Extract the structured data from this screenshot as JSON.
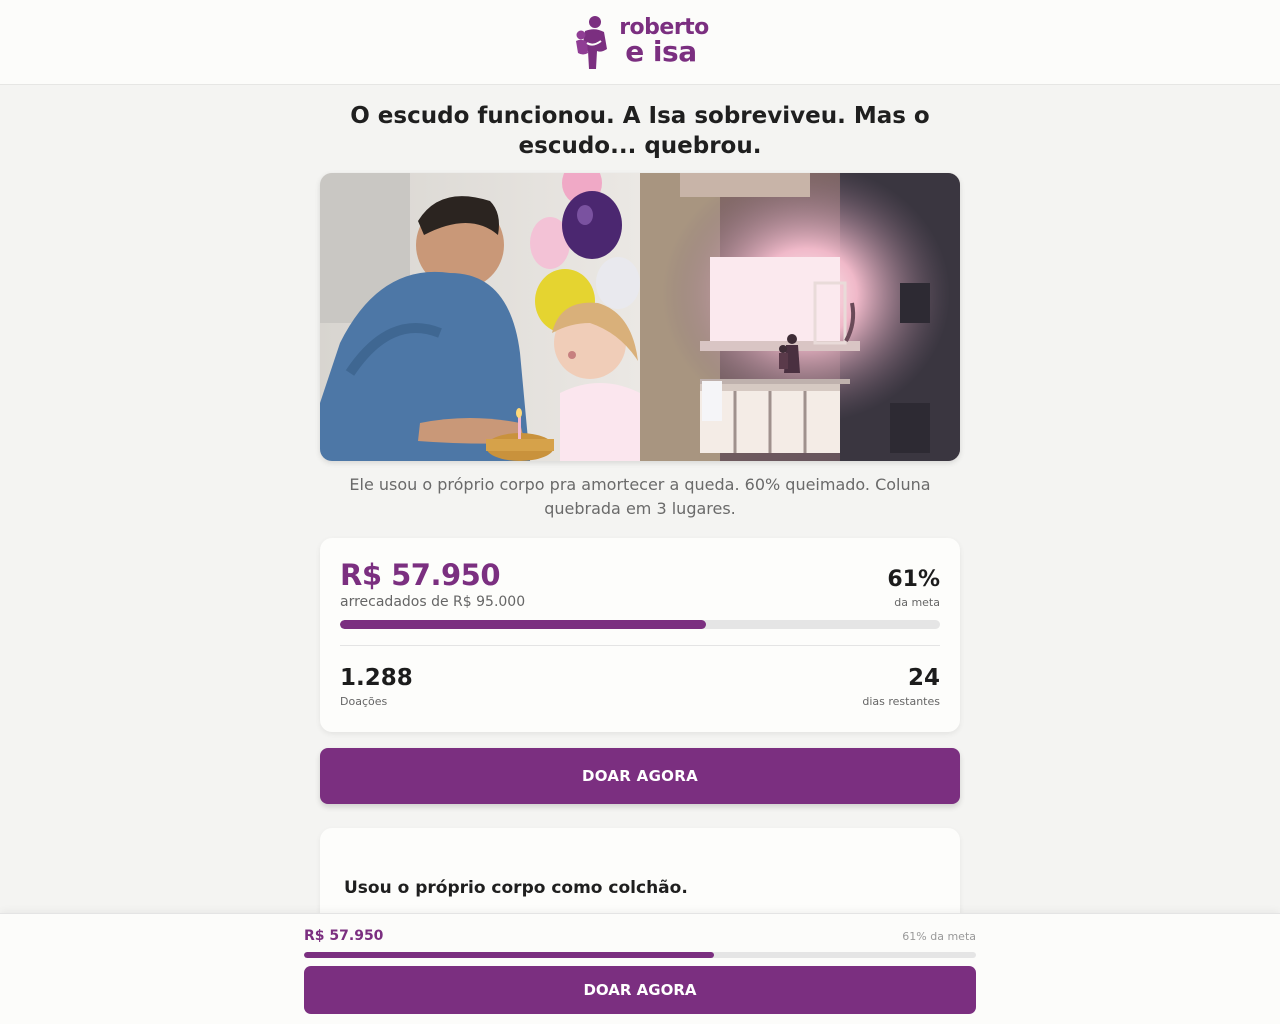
{
  "brand": {
    "line1": "roberto",
    "line2": "e isa",
    "accent": "#7b2f80"
  },
  "headline": "O escudo funcionou. A Isa sobreviveu. Mas o escudo... quebrou.",
  "caption": "Ele usou o próprio corpo pra amortecer a queda. 60% queimado. Coluna quebrada em 3 lugares.",
  "stats": {
    "raised": "R$ 57.950",
    "goal_label": "arrecadados de R$ 95.000",
    "percent": "61%",
    "percent_label": "da meta",
    "progress_fraction": 0.61,
    "donations": "1.288",
    "donations_label": "Doações",
    "days": "24",
    "days_label": "dias restantes"
  },
  "cta_label": "DOAR AGORA",
  "story": {
    "title": "Usou o próprio corpo como colchão."
  },
  "sticky": {
    "amount": "R$ 57.950",
    "percent_label": "61% da meta",
    "progress_fraction": 0.61,
    "cta_label": "DOAR AGORA"
  }
}
